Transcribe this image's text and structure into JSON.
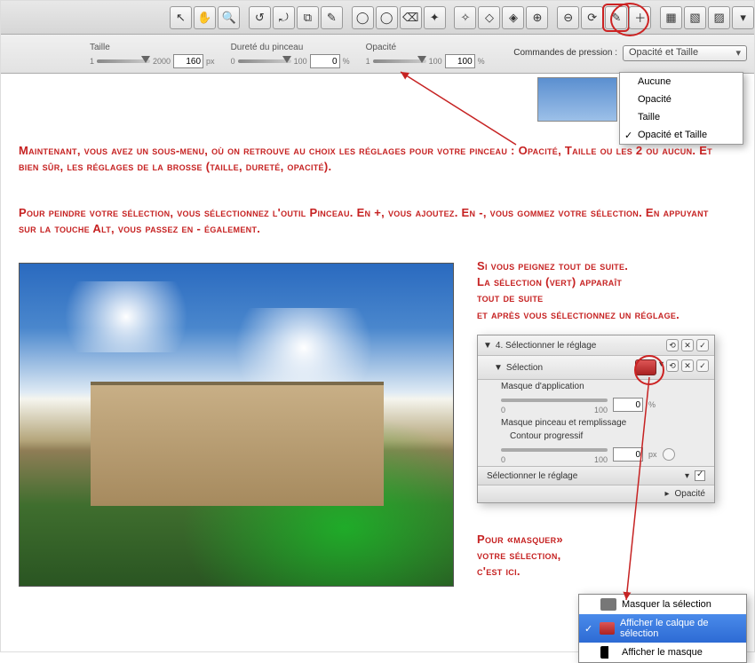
{
  "toolbar_icons": [
    "↖",
    "✋",
    "🔍",
    "↺",
    "⤾",
    "⧉",
    "✎",
    "◯",
    "◯",
    "⌫",
    "✦",
    "✧",
    "◇",
    "◈",
    "⊕",
    "⊖",
    "⟳",
    "✎",
    "＋",
    "▦",
    "▧",
    "▨",
    "▾"
  ],
  "highlight_tool_index": 17,
  "sub": {
    "taille": {
      "label": "Taille",
      "min": "1",
      "max": "2000",
      "value": "160",
      "unit": "px"
    },
    "durete": {
      "label": "Dureté du pinceau",
      "min": "0",
      "max": "100",
      "value": "0",
      "unit": "%"
    },
    "opacite": {
      "label": "Opacité",
      "min": "1",
      "max": "100",
      "value": "100",
      "unit": "%"
    },
    "pressure_label": "Commandes de pression :",
    "pressure_value": "Opacité et Taille"
  },
  "dd_options": [
    {
      "label": "Aucune",
      "checked": false
    },
    {
      "label": "Opacité",
      "checked": false
    },
    {
      "label": "Taille",
      "checked": false
    },
    {
      "label": "Opacité et Taille",
      "checked": true
    }
  ],
  "para1": "Maintenant, vous avez un sous-menu, où on retrouve au choix les réglages pour votre pinceau : Opacité, Taille ou les 2 ou aucun. Et bien sûr, les réglages de la brosse (taille, dureté, opacité).",
  "para2": "Pour peindre votre sélection, vous sélectionnez l'outil Pinceau. En +, vous ajoutez. En -, vous gommez votre sélection. En appuyant sur la touche Alt, vous passez en - également.",
  "side1": "Si vous peignez tout de suite.\nLa sélection (vert) apparaît\ntout de suite\net après vous sélectionnez un réglage.",
  "panel": {
    "title": "4. Sélectionner le réglage",
    "selection": "Sélection",
    "masque_app": "Masque d'application",
    "masque_app_min": "0",
    "masque_app_max": "100",
    "masque_app_val": "0",
    "masque_app_unit": "%",
    "masque_pinceau": "Masque pinceau et remplissage",
    "contour": "Contour progressif",
    "contour_min": "0",
    "contour_max": "100",
    "contour_val": "0",
    "contour_unit": "px",
    "select_reglage": "Sélectionner le réglage",
    "opacite": "Opacité"
  },
  "mask_text": "Pour «masquer»\nvotre sélection,\nc'est ici.",
  "ctx": [
    {
      "label": "Masquer la sélection",
      "icon": "grey",
      "selected": false
    },
    {
      "label": "Afficher le calque de sélection",
      "icon": "red",
      "selected": true
    },
    {
      "label": "Afficher le masque",
      "icon": "bw",
      "selected": false
    }
  ]
}
